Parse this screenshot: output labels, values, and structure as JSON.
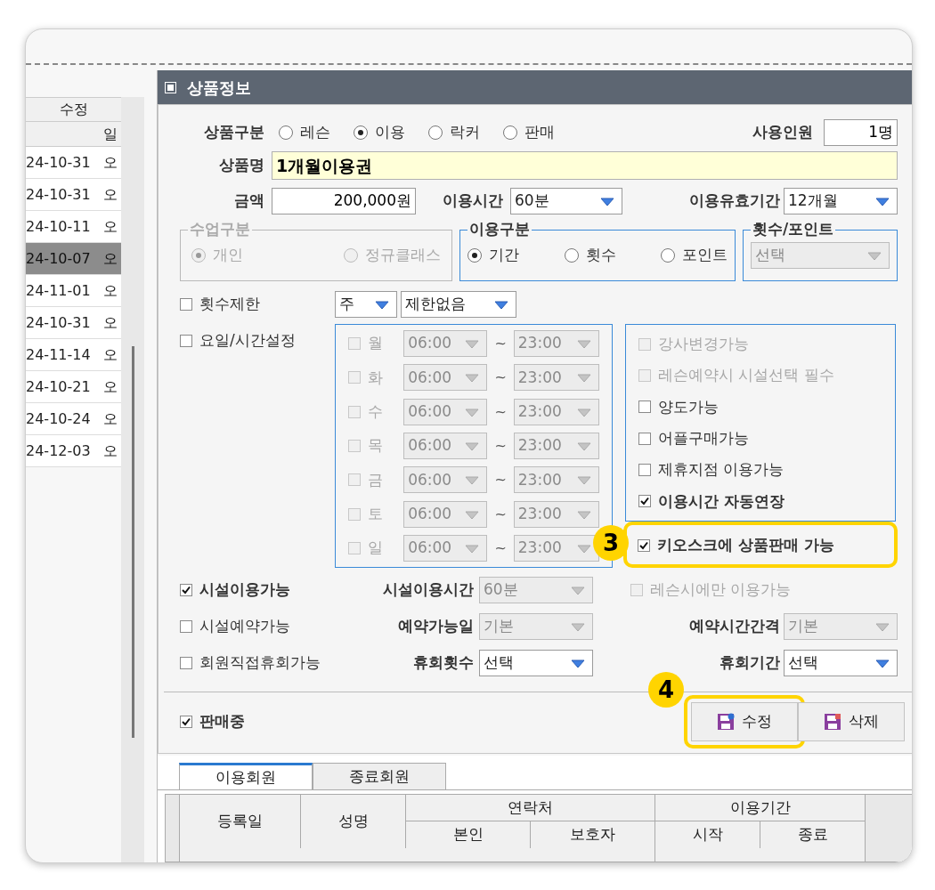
{
  "left_table": {
    "columns": [
      "수정",
      "일"
    ],
    "rows": [
      {
        "date": "24-10-31",
        "time": "오",
        "selected": false
      },
      {
        "date": "24-10-31",
        "time": "오",
        "selected": false
      },
      {
        "date": "24-10-11",
        "time": "오",
        "selected": false
      },
      {
        "date": "24-10-07",
        "time": "오",
        "selected": true
      },
      {
        "date": "24-11-01",
        "time": "오",
        "selected": false
      },
      {
        "date": "24-10-31",
        "time": "오",
        "selected": false
      },
      {
        "date": "24-11-14",
        "time": "오",
        "selected": false
      },
      {
        "date": "24-10-21",
        "time": "오",
        "selected": false
      },
      {
        "date": "24-10-24",
        "time": "오",
        "selected": false
      },
      {
        "date": "24-12-03",
        "time": "오",
        "selected": false
      }
    ]
  },
  "panel": {
    "title": "상품정보"
  },
  "product_type": {
    "label": "상품구분",
    "options": [
      {
        "label": "레슨",
        "selected": false
      },
      {
        "label": "이용",
        "selected": true
      },
      {
        "label": "락커",
        "selected": false
      },
      {
        "label": "판매",
        "selected": false
      }
    ]
  },
  "users": {
    "label": "사용인원",
    "value": "1명"
  },
  "product_name": {
    "label": "상품명",
    "value": "1개월이용권"
  },
  "price": {
    "label": "금액",
    "value": "200,000원"
  },
  "use_time": {
    "label": "이용시간",
    "value": "60분",
    "disabled": false
  },
  "validity": {
    "label": "이용유효기간",
    "value": "12개월",
    "disabled": false
  },
  "class_type": {
    "label": "수업구분",
    "disabled": true,
    "options": [
      {
        "label": "개인",
        "selected": true
      },
      {
        "label": "정규클래스",
        "selected": false
      }
    ]
  },
  "usage_type": {
    "label": "이용구분",
    "disabled": false,
    "options": [
      {
        "label": "기간",
        "selected": true
      },
      {
        "label": "횟수",
        "selected": false
      },
      {
        "label": "포인트",
        "selected": false
      }
    ]
  },
  "count_point": {
    "label": "횟수/포인트",
    "value": "선택",
    "disabled": true
  },
  "count_limit": {
    "label": "횟수제한",
    "checked": false,
    "unit": {
      "value": "주",
      "disabled": false
    },
    "limit": {
      "value": "제한없음",
      "disabled": false
    }
  },
  "day_time": {
    "label": "요일/시간설정",
    "checked": false,
    "days": [
      {
        "day": "월",
        "checked": false,
        "disabled": true,
        "start": "06:00",
        "separator": "~",
        "end": "23:00"
      },
      {
        "day": "화",
        "checked": false,
        "disabled": true,
        "start": "06:00",
        "separator": "~",
        "end": "23:00"
      },
      {
        "day": "수",
        "checked": false,
        "disabled": true,
        "start": "06:00",
        "separator": "~",
        "end": "23:00"
      },
      {
        "day": "목",
        "checked": false,
        "disabled": true,
        "start": "06:00",
        "separator": "~",
        "end": "23:00"
      },
      {
        "day": "금",
        "checked": false,
        "disabled": true,
        "start": "06:00",
        "separator": "~",
        "end": "23:00"
      },
      {
        "day": "토",
        "checked": false,
        "disabled": true,
        "start": "06:00",
        "separator": "~",
        "end": "23:00"
      },
      {
        "day": "일",
        "checked": false,
        "disabled": true,
        "start": "06:00",
        "separator": "~",
        "end": "23:00"
      }
    ]
  },
  "options": [
    {
      "label": "강사변경가능",
      "checked": false,
      "disabled": true
    },
    {
      "label": "레슨예약시 시설선택 필수",
      "checked": false,
      "disabled": true
    },
    {
      "label": "양도가능",
      "checked": false,
      "disabled": false
    },
    {
      "label": "어플구매가능",
      "checked": false,
      "disabled": false
    },
    {
      "label": "제휴지점 이용가능",
      "checked": false,
      "disabled": false
    },
    {
      "label": "이용시간 자동연장",
      "checked": true,
      "disabled": false
    },
    {
      "label": "키오스크에 상품판매 가능",
      "checked": true,
      "disabled": false,
      "callout": "3"
    }
  ],
  "facility_rows": [
    {
      "check": {
        "label": "시설이용가능",
        "checked": true,
        "disabled": false
      },
      "select": {
        "label": "시설이용시간",
        "value": "60분",
        "disabled": true
      },
      "right": {
        "kind": "check",
        "label": "레슨시에만 이용가능",
        "checked": false,
        "disabled": true
      }
    },
    {
      "check": {
        "label": "시설예약가능",
        "checked": false,
        "disabled": false
      },
      "select": {
        "label": "예약가능일",
        "value": "기본",
        "disabled": true
      },
      "right": {
        "kind": "select",
        "label": "예약시간간격",
        "value": "기본",
        "disabled": true
      }
    },
    {
      "check": {
        "label": "회원직접휴회가능",
        "checked": false,
        "disabled": false
      },
      "select": {
        "label": "휴회횟수",
        "value": "선택",
        "disabled": false
      },
      "right": {
        "kind": "select",
        "label": "휴회기간",
        "value": "선택",
        "disabled": false
      }
    }
  ],
  "on_sale": {
    "label": "판매중",
    "checked": true
  },
  "buttons": [
    {
      "label": "수정",
      "kind": "edit",
      "callout": "4"
    },
    {
      "label": "삭제",
      "kind": "delete"
    }
  ],
  "member_tabs": [
    {
      "label": "이용회원",
      "selected": true
    },
    {
      "label": "종료회원",
      "selected": false
    }
  ],
  "members_table": {
    "columns": [
      {
        "label": "등록일"
      },
      {
        "label": "성명"
      },
      {
        "label": "연락처",
        "children": [
          {
            "label": "본인"
          },
          {
            "label": "보호자"
          }
        ]
      },
      {
        "label": "이용기간",
        "children": [
          {
            "label": "시작"
          },
          {
            "label": "종료"
          }
        ]
      }
    ]
  }
}
